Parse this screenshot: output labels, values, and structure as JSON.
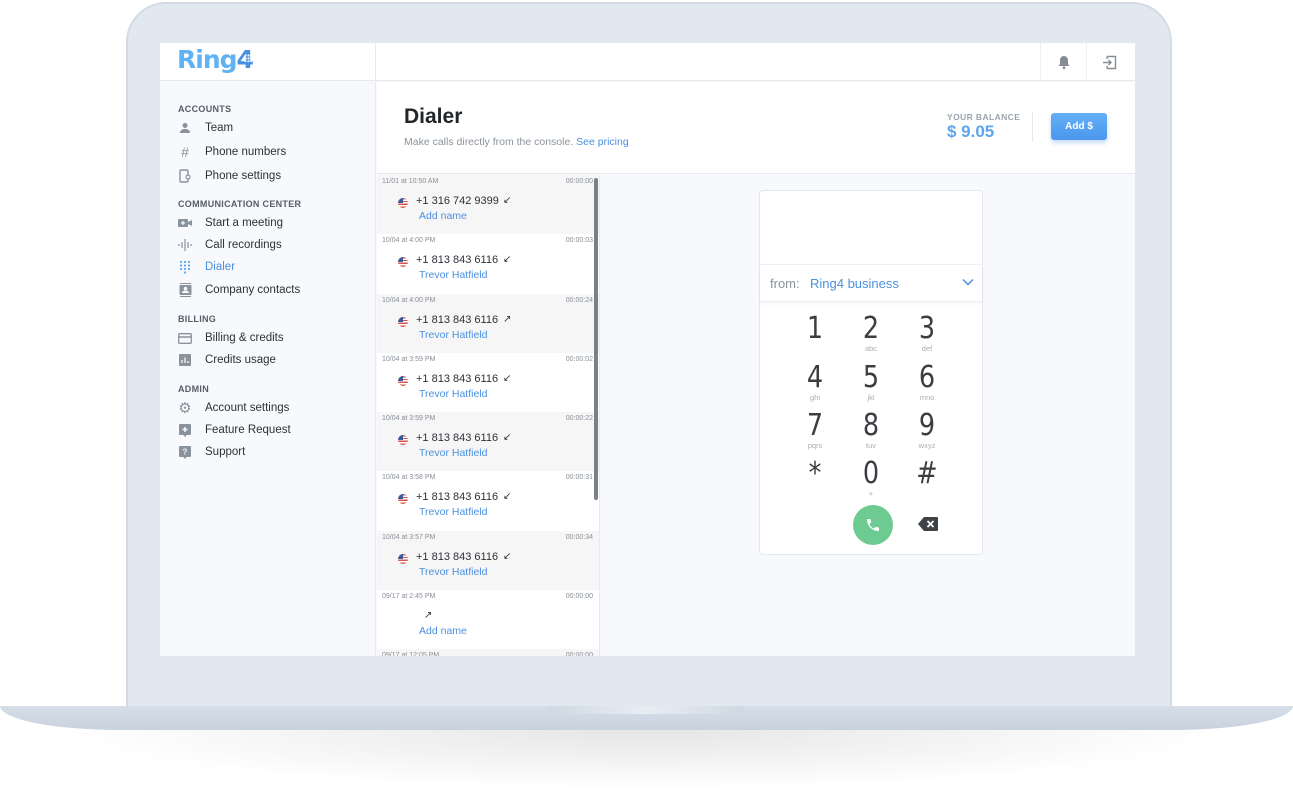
{
  "app": {
    "logo_text": "Ring",
    "logo_digit": "4"
  },
  "topbar": {
    "icons": [
      "bell-icon",
      "logout-icon"
    ]
  },
  "sidebar": {
    "sections": [
      {
        "title": "ACCOUNTS",
        "items": [
          {
            "label": "Team",
            "icon": "person-icon"
          },
          {
            "label": "Phone numbers",
            "icon": "hash-icon"
          },
          {
            "label": "Phone settings",
            "icon": "phone-settings-icon"
          }
        ]
      },
      {
        "title": "COMMUNICATION CENTER",
        "items": [
          {
            "label": "Start a meeting",
            "icon": "video-icon"
          },
          {
            "label": "Call recordings",
            "icon": "waveform-icon"
          },
          {
            "label": "Dialer",
            "icon": "dialpad-icon",
            "active": true
          },
          {
            "label": "Company contacts",
            "icon": "contacts-icon"
          }
        ]
      },
      {
        "title": "BILLING",
        "items": [
          {
            "label": "Billing & credits",
            "icon": "credit-card-icon"
          },
          {
            "label": "Credits usage",
            "icon": "bar-chart-icon"
          }
        ]
      },
      {
        "title": "ADMIN",
        "items": [
          {
            "label": "Account settings",
            "icon": "gear-icon"
          },
          {
            "label": "Feature Request",
            "icon": "plus-box-icon"
          },
          {
            "label": "Support",
            "icon": "help-icon"
          }
        ]
      }
    ]
  },
  "header": {
    "title": "Dialer",
    "subtitle": "Make calls directly from the console.",
    "pricing_link": "See pricing",
    "balance_label": "YOUR BALANCE",
    "balance_value": "$ 9.05",
    "add_button": "Add $"
  },
  "calls": [
    {
      "time": "11/01 at 10:50 AM",
      "duration": "00:00:00",
      "number": "+1 316 742 9399",
      "direction": "incoming",
      "name": "Add name",
      "flag": true
    },
    {
      "time": "10/04 at 4:00 PM",
      "duration": "00:00:03",
      "number": "+1 813 843 6116",
      "direction": "incoming",
      "name": "Trevor Hatfield",
      "flag": true
    },
    {
      "time": "10/04 at 4:00 PM",
      "duration": "00:00:24",
      "number": "+1 813 843 6116",
      "direction": "outgoing",
      "name": "Trevor Hatfield",
      "flag": true
    },
    {
      "time": "10/04 at 3:59 PM",
      "duration": "00:00:02",
      "number": "+1 813 843 6116",
      "direction": "incoming",
      "name": "Trevor Hatfield",
      "flag": true
    },
    {
      "time": "10/04 at 3:59 PM",
      "duration": "00:00:22",
      "number": "+1 813 843 6116",
      "direction": "incoming",
      "name": "Trevor Hatfield",
      "flag": true
    },
    {
      "time": "10/04 at 3:58 PM",
      "duration": "00:00:31",
      "number": "+1 813 843 6116",
      "direction": "incoming",
      "name": "Trevor Hatfield",
      "flag": true
    },
    {
      "time": "10/04 at 3:57 PM",
      "duration": "00:00:34",
      "number": "+1 813 843 6116",
      "direction": "incoming",
      "name": "Trevor Hatfield",
      "flag": true
    },
    {
      "time": "09/17 at 2:45 PM",
      "duration": "00:00:00",
      "number": "",
      "direction": "outgoing",
      "name": "Add name",
      "flag": false
    },
    {
      "time": "09/17 at 12:05 PM",
      "duration": "00:00:00",
      "number": "",
      "direction": "",
      "name": "",
      "flag": false
    }
  ],
  "dialer": {
    "from_label": "from:",
    "from_value": "Ring4 business",
    "display_value": "",
    "keys": [
      {
        "digit": "1",
        "letters": ""
      },
      {
        "digit": "2",
        "letters": "abc"
      },
      {
        "digit": "3",
        "letters": "def"
      },
      {
        "digit": "4",
        "letters": "ghi"
      },
      {
        "digit": "5",
        "letters": "jkl"
      },
      {
        "digit": "6",
        "letters": "mno"
      },
      {
        "digit": "7",
        "letters": "pqrs"
      },
      {
        "digit": "8",
        "letters": "tuv"
      },
      {
        "digit": "9",
        "letters": "wxyz"
      },
      {
        "digit": "*",
        "letters": ""
      },
      {
        "digit": "0",
        "letters": "+"
      },
      {
        "digit": "#",
        "letters": ""
      }
    ],
    "colors": {
      "call": "#6dcb91",
      "accent": "#4a90e2"
    }
  }
}
